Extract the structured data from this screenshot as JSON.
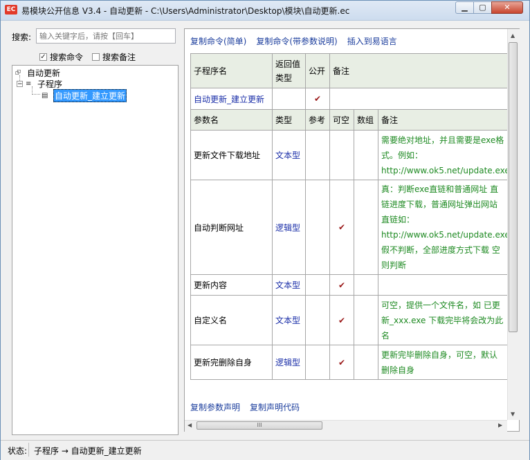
{
  "window": {
    "title": "易模块公开信息 V3.4 - 自动更新 - C:\\Users\\Administrator\\Desktop\\模块\\自动更新.ec",
    "app_icon_text": "EC",
    "minimize": "▁",
    "maximize": "▢",
    "close": "✕"
  },
  "search": {
    "label": "搜索:",
    "placeholder": "输入关键字后，请按【回车】"
  },
  "options": {
    "search_commands": "搜索命令",
    "search_commands_checked": "✓",
    "search_notes": "搜索备注"
  },
  "tree": {
    "root": "自动更新",
    "folder": "子程序",
    "expander": "−",
    "selected": "自动更新_建立更新"
  },
  "links": {
    "copy_simple": "复制命令(简单)",
    "copy_with_params": "复制命令(带参数说明)",
    "insert": "插入到易语言",
    "copy_param_decl": "复制参数声明",
    "copy_decl_code": "复制声明代码"
  },
  "proc_table": {
    "headers": {
      "name": "子程序名",
      "return_type_1": "返回值",
      "return_type_2": "类型",
      "public": "公开",
      "note": "备注"
    },
    "row": {
      "name": "自动更新_建立更新",
      "return_type": "",
      "public": "✔",
      "note": ""
    }
  },
  "param_table": {
    "headers": {
      "name": "参数名",
      "type": "类型",
      "ref": "参考",
      "nullable": "可空",
      "array": "数组",
      "note": "备注"
    },
    "rows": [
      {
        "name": "更新文件下载地址",
        "type": "文本型",
        "ref": "",
        "nullable": "",
        "array": "",
        "note_lines": [
          "需要绝对地址，并且需要是exe格",
          "式。例如：",
          "http://www.ok5.net/update.exe"
        ]
      },
      {
        "name": "自动判断网址",
        "type": "逻辑型",
        "ref": "",
        "nullable": "✔",
        "array": "",
        "note_lines": [
          "真：判断exe直链和普通网址 直",
          "链进度下载，普通网址弹出网站",
          "直链如：",
          "http://www.ok5.net/update.exe",
          "假不判断，全部进度方式下载 空",
          "则判断"
        ]
      },
      {
        "name": "更新内容",
        "type": "文本型",
        "ref": "",
        "nullable": "✔",
        "array": "",
        "note_lines": [
          ""
        ]
      },
      {
        "name": "自定义名",
        "type": "文本型",
        "ref": "",
        "nullable": "✔",
        "array": "",
        "note_lines": [
          "可空，提供一个文件名，如 已更",
          "新_xxx.exe 下载完毕将会改为此",
          "名"
        ]
      },
      {
        "name": "更新完删除自身",
        "type": "逻辑型",
        "ref": "",
        "nullable": "✔",
        "array": "",
        "note_lines": [
          "更新完毕删除自身，可空，默认",
          "删除自身"
        ]
      }
    ]
  },
  "scroll": {
    "h_grip": "III",
    "up": "▲",
    "down": "▼",
    "left": "◀",
    "right": "▶"
  },
  "status": {
    "label": "状态:",
    "text": "子程序 → 自动更新_建立更新"
  }
}
